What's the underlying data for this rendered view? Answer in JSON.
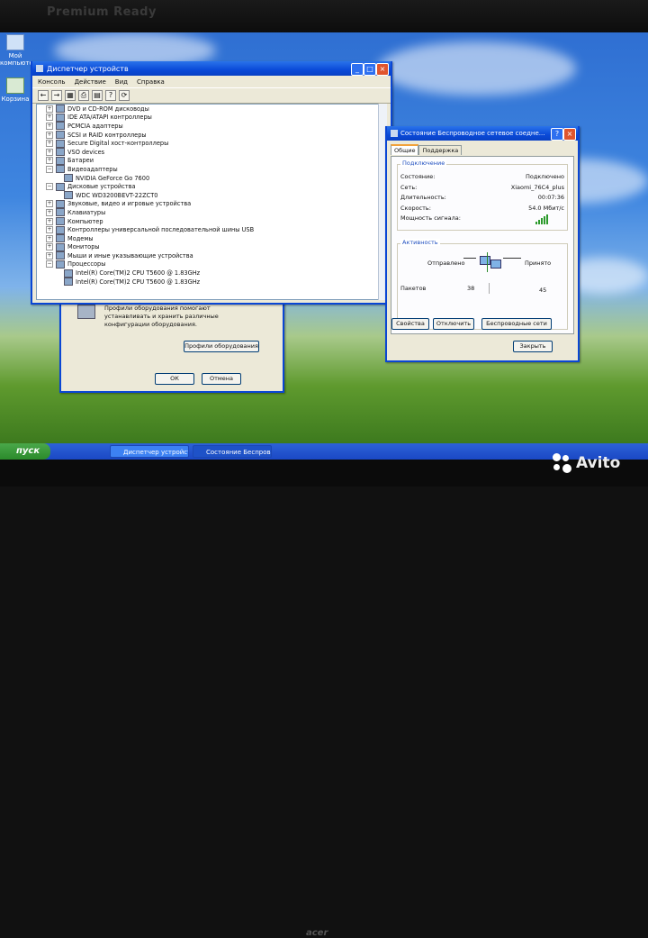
{
  "brand_text": "Premium Ready",
  "desktop_icons": [
    {
      "label": "Мой\nкомпьютер"
    },
    {
      "label": "Корзина"
    }
  ],
  "device_manager": {
    "title": "Диспетчер устройств",
    "menu": [
      "Консоль",
      "Действие",
      "Вид",
      "Справка"
    ],
    "tree": [
      {
        "label": "DVD и CD-ROM дисководы",
        "expanded": false,
        "indent": 0
      },
      {
        "label": "IDE ATA/ATAPI контроллеры",
        "expanded": false,
        "indent": 0
      },
      {
        "label": "PCMCIA адаптеры",
        "expanded": false,
        "indent": 0
      },
      {
        "label": "SCSI и RAID контроллеры",
        "expanded": false,
        "indent": 0
      },
      {
        "label": "Secure Digital хост-контроллеры",
        "expanded": false,
        "indent": 0
      },
      {
        "label": "VSO devices",
        "expanded": false,
        "indent": 0
      },
      {
        "label": "Батареи",
        "expanded": false,
        "indent": 0
      },
      {
        "label": "Видеоадаптеры",
        "expanded": true,
        "indent": 0
      },
      {
        "label": "NVIDIA GeForce Go 7600",
        "expanded": null,
        "indent": 1
      },
      {
        "label": "Дисковые устройства",
        "expanded": true,
        "indent": 0
      },
      {
        "label": "WDC WD3200BEVT-22ZCT0",
        "expanded": null,
        "indent": 1
      },
      {
        "label": "Звуковые, видео и игровые устройства",
        "expanded": false,
        "indent": 0
      },
      {
        "label": "Клавиатуры",
        "expanded": false,
        "indent": 0
      },
      {
        "label": "Компьютер",
        "expanded": false,
        "indent": 0
      },
      {
        "label": "Контроллеры универсальной последовательной шины USB",
        "expanded": false,
        "indent": 0
      },
      {
        "label": "Модемы",
        "expanded": false,
        "indent": 0
      },
      {
        "label": "Мониторы",
        "expanded": false,
        "indent": 0
      },
      {
        "label": "Мыши и иные указывающие устройства",
        "expanded": false,
        "indent": 0
      },
      {
        "label": "Процессоры",
        "expanded": true,
        "indent": 0
      },
      {
        "label": "Intel(R) Core(TM)2 CPU        T5600  @ 1.83GHz",
        "expanded": null,
        "indent": 1
      },
      {
        "label": "Intel(R) Core(TM)2 CPU        T5600  @ 1.83GHz",
        "expanded": null,
        "indent": 1
      }
    ]
  },
  "system_props": {
    "profiles_text": "Профили оборудования помогают устанавливать и хранить различные конфигурации оборудования.",
    "profiles_button": "Профили оборудования",
    "ok": "ОК",
    "cancel": "Отмена"
  },
  "wireless": {
    "title": "Состояние Беспроводное сетевое соедне...",
    "tabs": [
      "Общие",
      "Поддержка"
    ],
    "connection_legend": "Подключение",
    "fields": [
      {
        "label": "Состояние:",
        "value": "Подключено"
      },
      {
        "label": "Сеть:",
        "value": "Xiaomi_76C4_plus"
      },
      {
        "label": "Длительность:",
        "value": "00:07:36"
      },
      {
        "label": "Скорость:",
        "value": "54.0 Мбит/с"
      },
      {
        "label": "Мощность сигнала:",
        "value": ""
      }
    ],
    "activity_legend": "Активность",
    "sent_label": "Отправлено",
    "received_label": "Принято",
    "packets_label": "Пакетов",
    "packets_sent": "38",
    "packets_received": "45",
    "buttons": [
      "Свойства",
      "Отключить",
      "Беспроводные сети"
    ],
    "close": "Закрыть"
  },
  "taskbar": {
    "start": "пуск",
    "tasks": [
      "Диспетчер устройств",
      "Состояние Беспрово..."
    ]
  },
  "watermark": "Avito",
  "laptop_brand": "acer"
}
